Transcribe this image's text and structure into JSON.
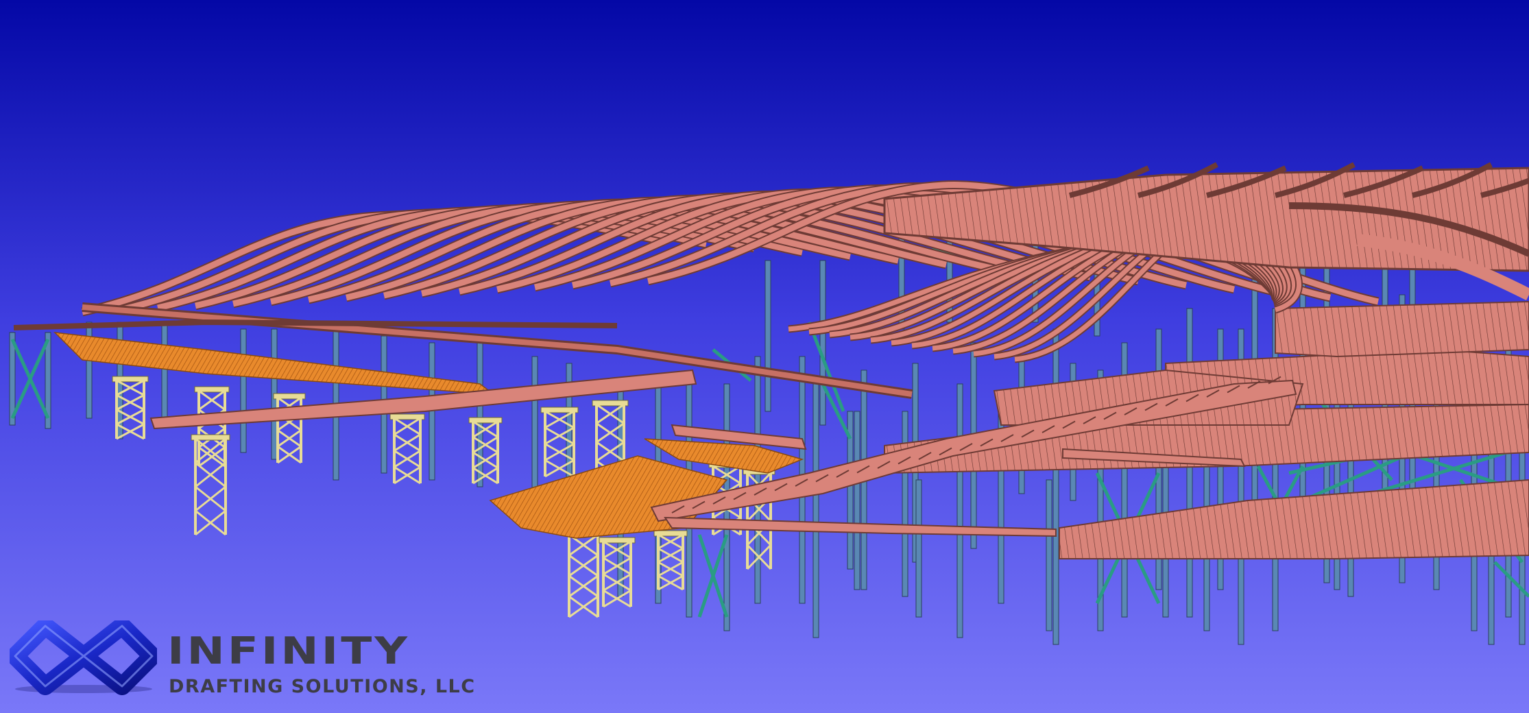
{
  "scene": {
    "subject": "3D steel structure model",
    "colors": {
      "sky_top": "#0408a6",
      "sky_bottom": "#7a78f8",
      "roof_beam": "#d9847a",
      "roof_edge": "#6e3b35",
      "decking": "#e98a2c",
      "column": "#5a88b4",
      "brace": "#2a9c84",
      "truss": "#e8dc96"
    }
  },
  "logo": {
    "brand_name": "INFINITY",
    "tagline": "DRAFTING SOLUTIONS, LLC",
    "icon": "infinity-knot-icon",
    "colors": {
      "icon": "#1a28c8",
      "text": "#3d3d46"
    }
  }
}
